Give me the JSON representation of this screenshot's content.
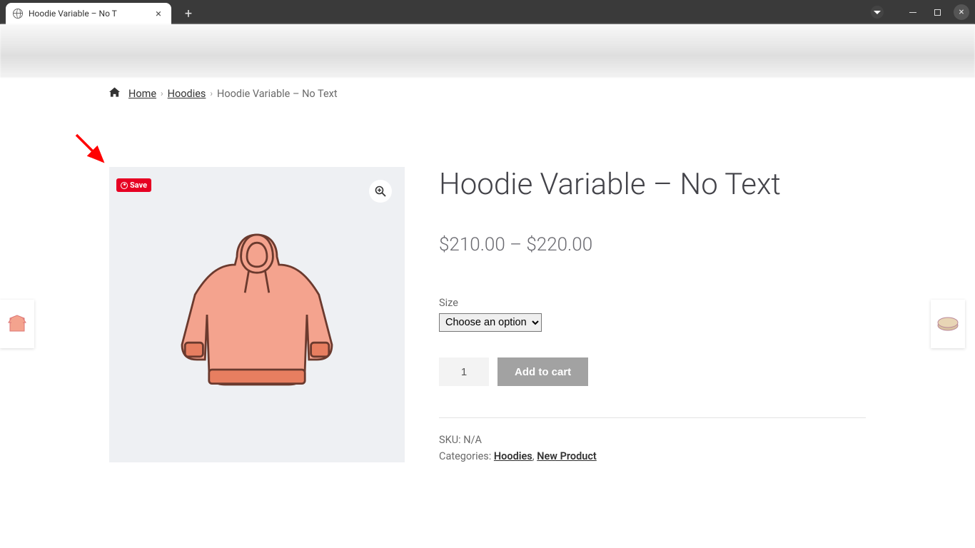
{
  "browser": {
    "tab_title": "Hoodie Variable – No T"
  },
  "breadcrumb": {
    "home": "Home",
    "cat": "Hoodies",
    "current": "Hoodie Variable – No Text"
  },
  "product": {
    "title": "Hoodie Variable – No Text",
    "price_html": "$210.00 – $220.00",
    "size_label": "Size",
    "size_placeholder": "Choose an option",
    "qty": "1",
    "add_to_cart": "Add to cart",
    "sku_label": "SKU: ",
    "sku_value": "N/A",
    "cat_label": "Categories: ",
    "cat1": "Hoodies",
    "sep": ", ",
    "cat2": "New Product",
    "pin_save": "Save"
  }
}
